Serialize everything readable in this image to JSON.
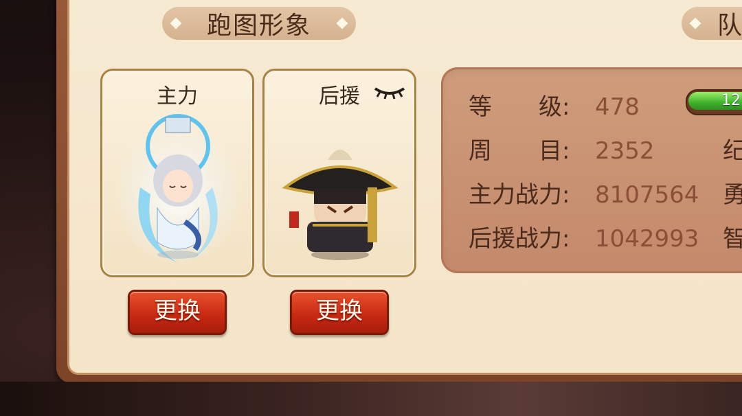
{
  "sections": {
    "left_title": "跑图形象",
    "right_title_partial": "队"
  },
  "cards": [
    {
      "label": "主力",
      "button": "更换"
    },
    {
      "label": "后援",
      "button": "更换"
    }
  ],
  "stats": [
    {
      "label": "等　　级:",
      "value": "478"
    },
    {
      "label": "周　　目:",
      "value": "2352"
    },
    {
      "label": "主力战力:",
      "value": "8107564"
    },
    {
      "label": "后援战力:",
      "value": "1042993"
    }
  ],
  "right_column_partial": [
    "纪",
    "勇",
    "智"
  ],
  "level_bar": {
    "text": "12",
    "fill_color": "#3fb12b"
  },
  "icons": {
    "eye": "closed-eye-icon"
  }
}
